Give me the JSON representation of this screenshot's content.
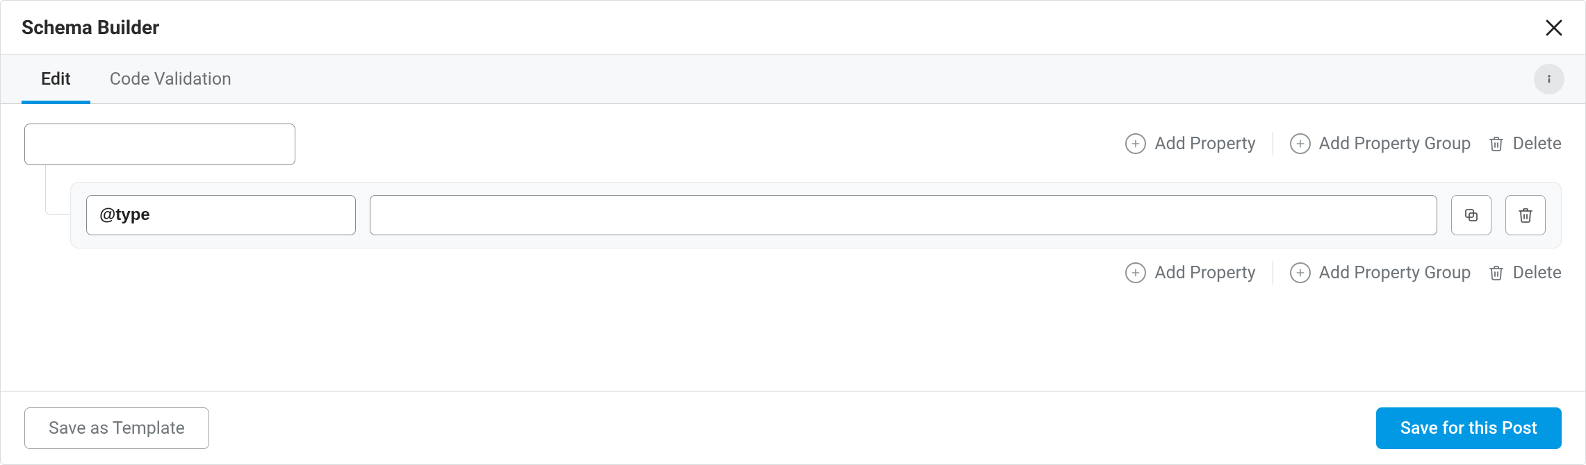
{
  "header": {
    "title": "Schema Builder"
  },
  "tabs": {
    "edit": "Edit",
    "code_validation": "Code Validation"
  },
  "editor": {
    "root_value": "",
    "property": {
      "key": "@type",
      "value": ""
    }
  },
  "actions": {
    "add_property": "Add Property",
    "add_property_group": "Add Property Group",
    "delete": "Delete"
  },
  "footer": {
    "save_template": "Save as Template",
    "save_post": "Save for this Post"
  }
}
